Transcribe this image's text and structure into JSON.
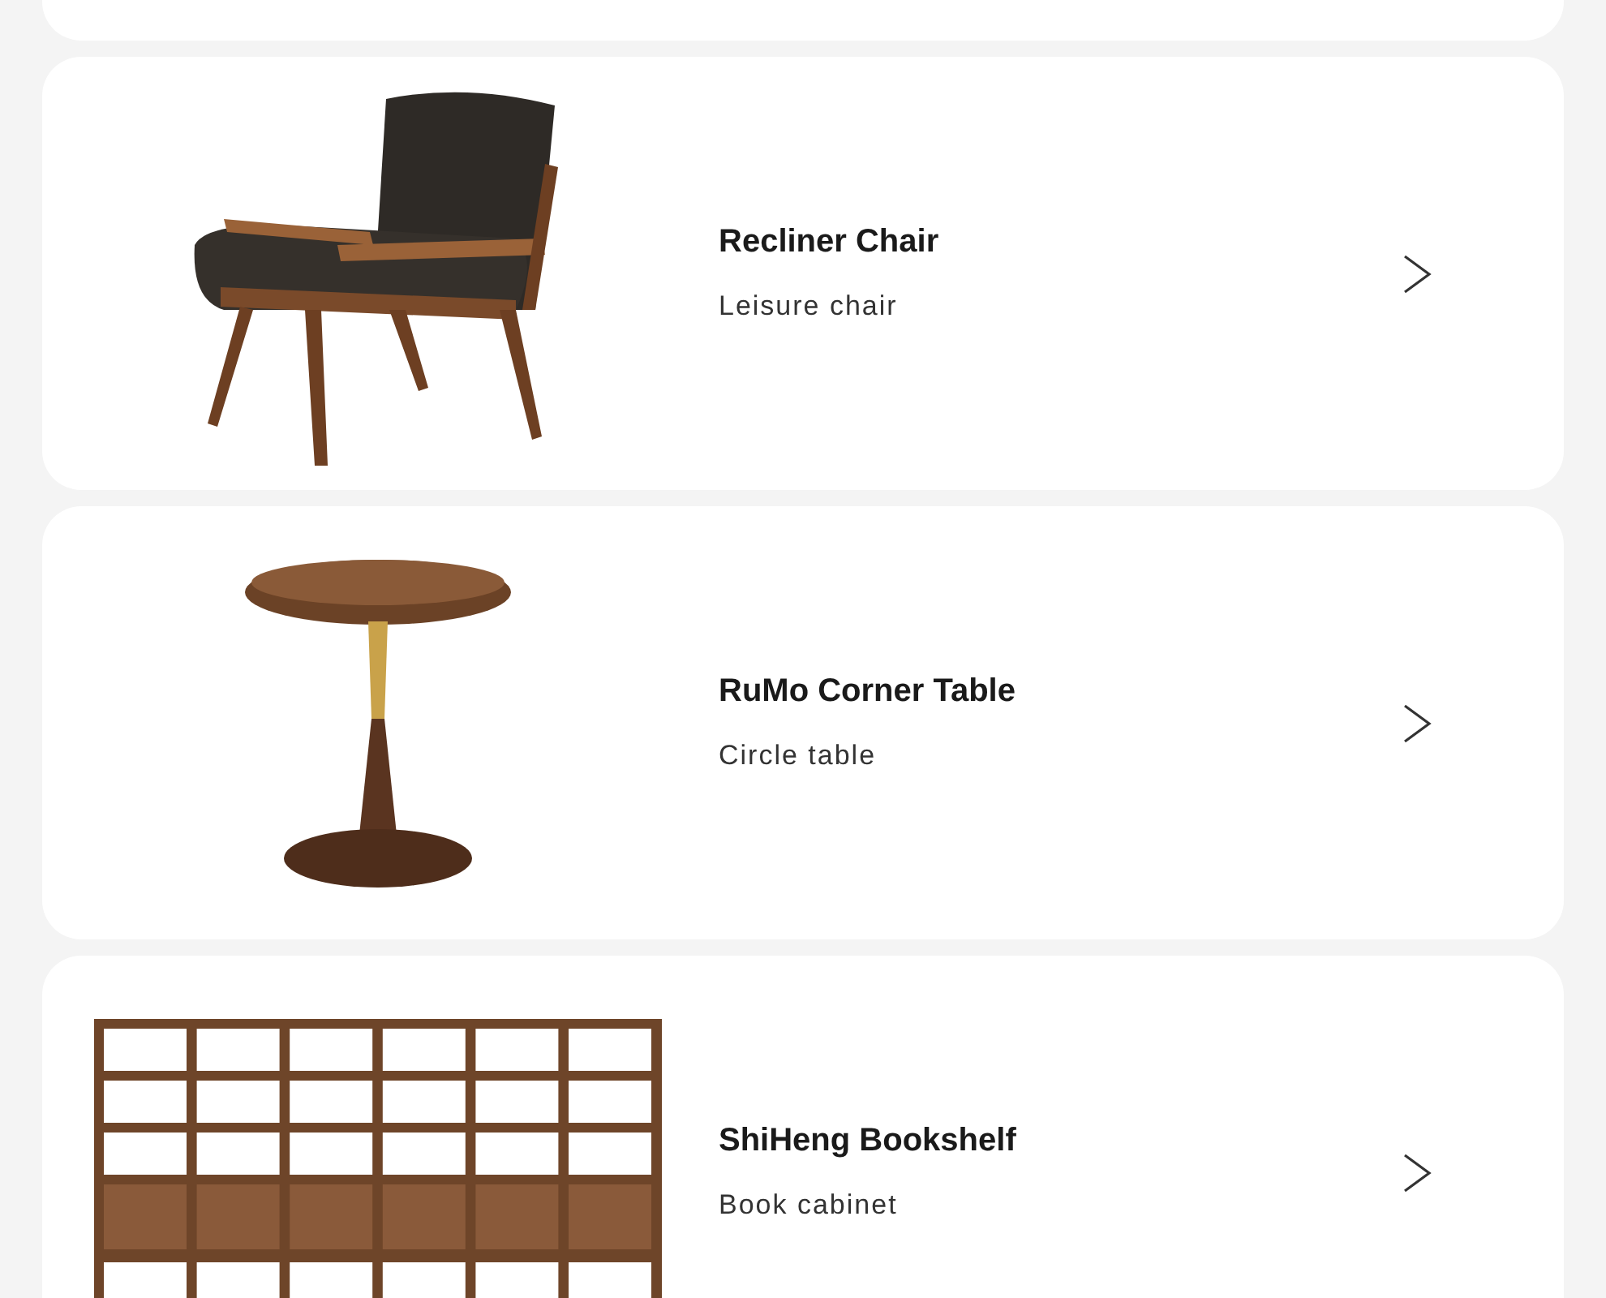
{
  "items": [
    {
      "kind": "chair",
      "title": "Recliner Chair",
      "subtitle": "Leisure chair"
    },
    {
      "kind": "table",
      "title": "RuMo Corner Table",
      "subtitle": "Circle table"
    },
    {
      "kind": "bookshelf",
      "title": "ShiHeng Bookshelf",
      "subtitle": "Book cabinet"
    }
  ]
}
